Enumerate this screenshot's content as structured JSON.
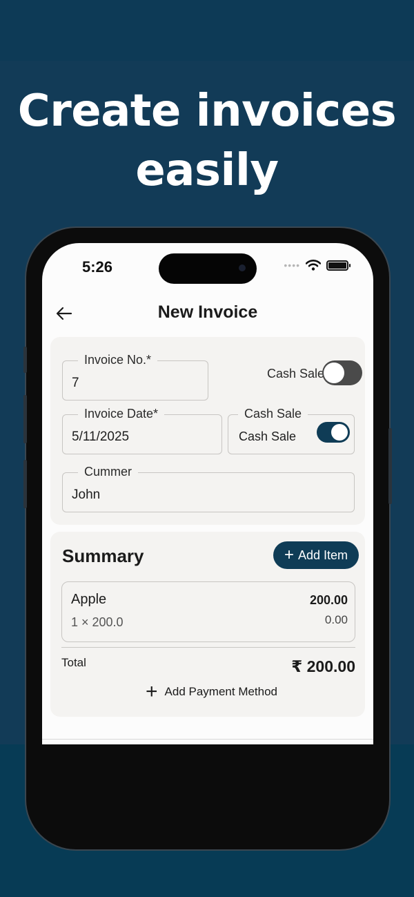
{
  "headline": "Create invoices easily",
  "status_bar": {
    "time": "5:26",
    "signal_dots": "••••"
  },
  "header": {
    "title": "New Invoice",
    "back_icon": "arrow-left-icon"
  },
  "form": {
    "invoice_no_label": "Invoice No.*",
    "invoice_no_value": "7",
    "cash_sale_top_label": "Cash Sale",
    "cash_sale_top_on": false,
    "invoice_date_label": "Invoice Date*",
    "invoice_date_value": "5/11/2025",
    "cash_sale_box_label": "Cash Sale",
    "cash_sale_box_text": "Cash Sale",
    "cash_sale_box_on": true,
    "customer_label": "Cummer",
    "customer_value": "John"
  },
  "summary": {
    "title": "Summary",
    "add_item_label": "Add Item",
    "items": [
      {
        "name": "Apple",
        "qty_price": "1 × 200.0",
        "amount": "200.00",
        "tax": "0.00"
      }
    ],
    "total_label": "Total",
    "total_amount": "₹ 200.00",
    "add_payment_label": "Add Payment Method"
  },
  "colors": {
    "accent": "#0f3c56",
    "background": "#123b57",
    "toggle_off": "#4a4a4a"
  }
}
